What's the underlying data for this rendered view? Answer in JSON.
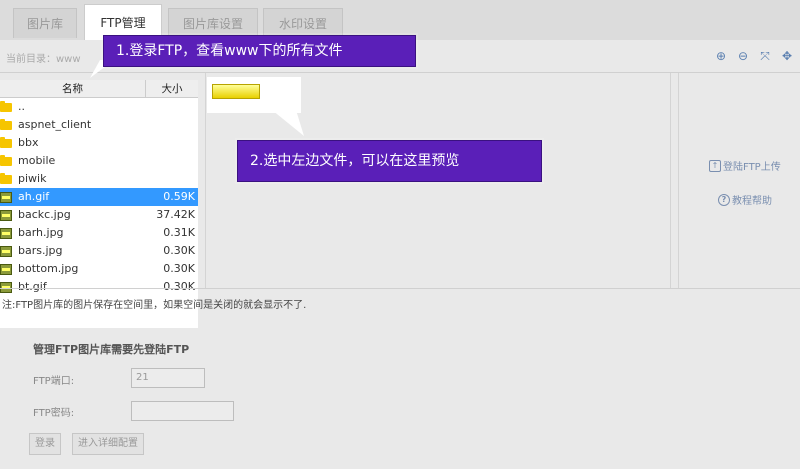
{
  "tabs": [
    {
      "label": "图片库"
    },
    {
      "label": "FTP管理"
    },
    {
      "label": "图片库设置"
    },
    {
      "label": "水印设置"
    }
  ],
  "toolbar": {
    "current_dir": "当前目录：www"
  },
  "file_list": {
    "col_name": "名称",
    "col_size": "大小",
    "rows": [
      {
        "type": "folder",
        "name": "..",
        "size": ""
      },
      {
        "type": "folder",
        "name": "aspnet_client",
        "size": ""
      },
      {
        "type": "folder",
        "name": "bbx",
        "size": ""
      },
      {
        "type": "folder",
        "name": "mobile",
        "size": ""
      },
      {
        "type": "folder",
        "name": "piwik",
        "size": ""
      },
      {
        "type": "file",
        "name": "ah.gif",
        "size": "0.59K",
        "selected": true
      },
      {
        "type": "file",
        "name": "backc.jpg",
        "size": "37.42K"
      },
      {
        "type": "file",
        "name": "barh.jpg",
        "size": "0.31K"
      },
      {
        "type": "file",
        "name": "bars.jpg",
        "size": "0.30K"
      },
      {
        "type": "file",
        "name": "bottom.jpg",
        "size": "0.30K"
      },
      {
        "type": "file",
        "name": "bt.gif",
        "size": "0.30K"
      }
    ]
  },
  "side_links": {
    "upload": "登陆FTP上传",
    "help": "教程帮助"
  },
  "note": "注:FTP图片库的图片保存在空间里，如果空间是关闭的就会显示不了.",
  "login": {
    "title": "管理FTP图片库需要先登陆FTP",
    "port_label": "FTP端口:",
    "port_value": "21",
    "password_label": "FTP密码:",
    "login_button": "登录",
    "detail_button": "进入详细配置"
  },
  "callouts": {
    "step1": "1.登录FTP，查看www下的所有文件",
    "step2": "2.选中左边文件，可以在这里预览"
  },
  "colors": {
    "callout_bg": "#5a1fb8",
    "selection": "#3399ff"
  }
}
